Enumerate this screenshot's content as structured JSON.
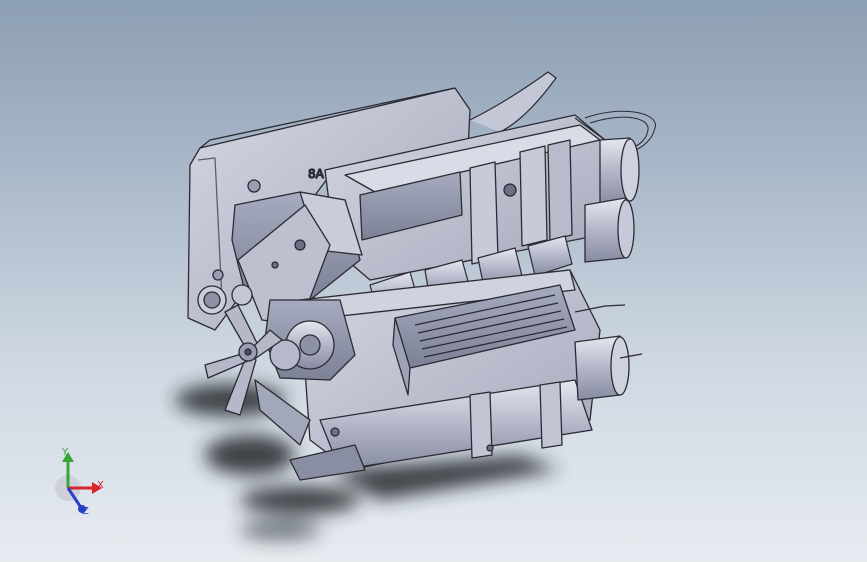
{
  "viewport": {
    "background_top": "#8d9fb4",
    "background_bottom": "#e6ebf0"
  },
  "model": {
    "engraved_text": "8A",
    "body_color": "#b9bccd",
    "body_dark": "#8e92a6",
    "edge_color": "#2b2b33",
    "shadow_color": "#23262c"
  },
  "triad": {
    "x_label": "X",
    "y_label": "Y",
    "z_label": "Z",
    "x_color": "#d6262b",
    "y_color": "#3aa33a",
    "z_color": "#2a3fc7"
  }
}
